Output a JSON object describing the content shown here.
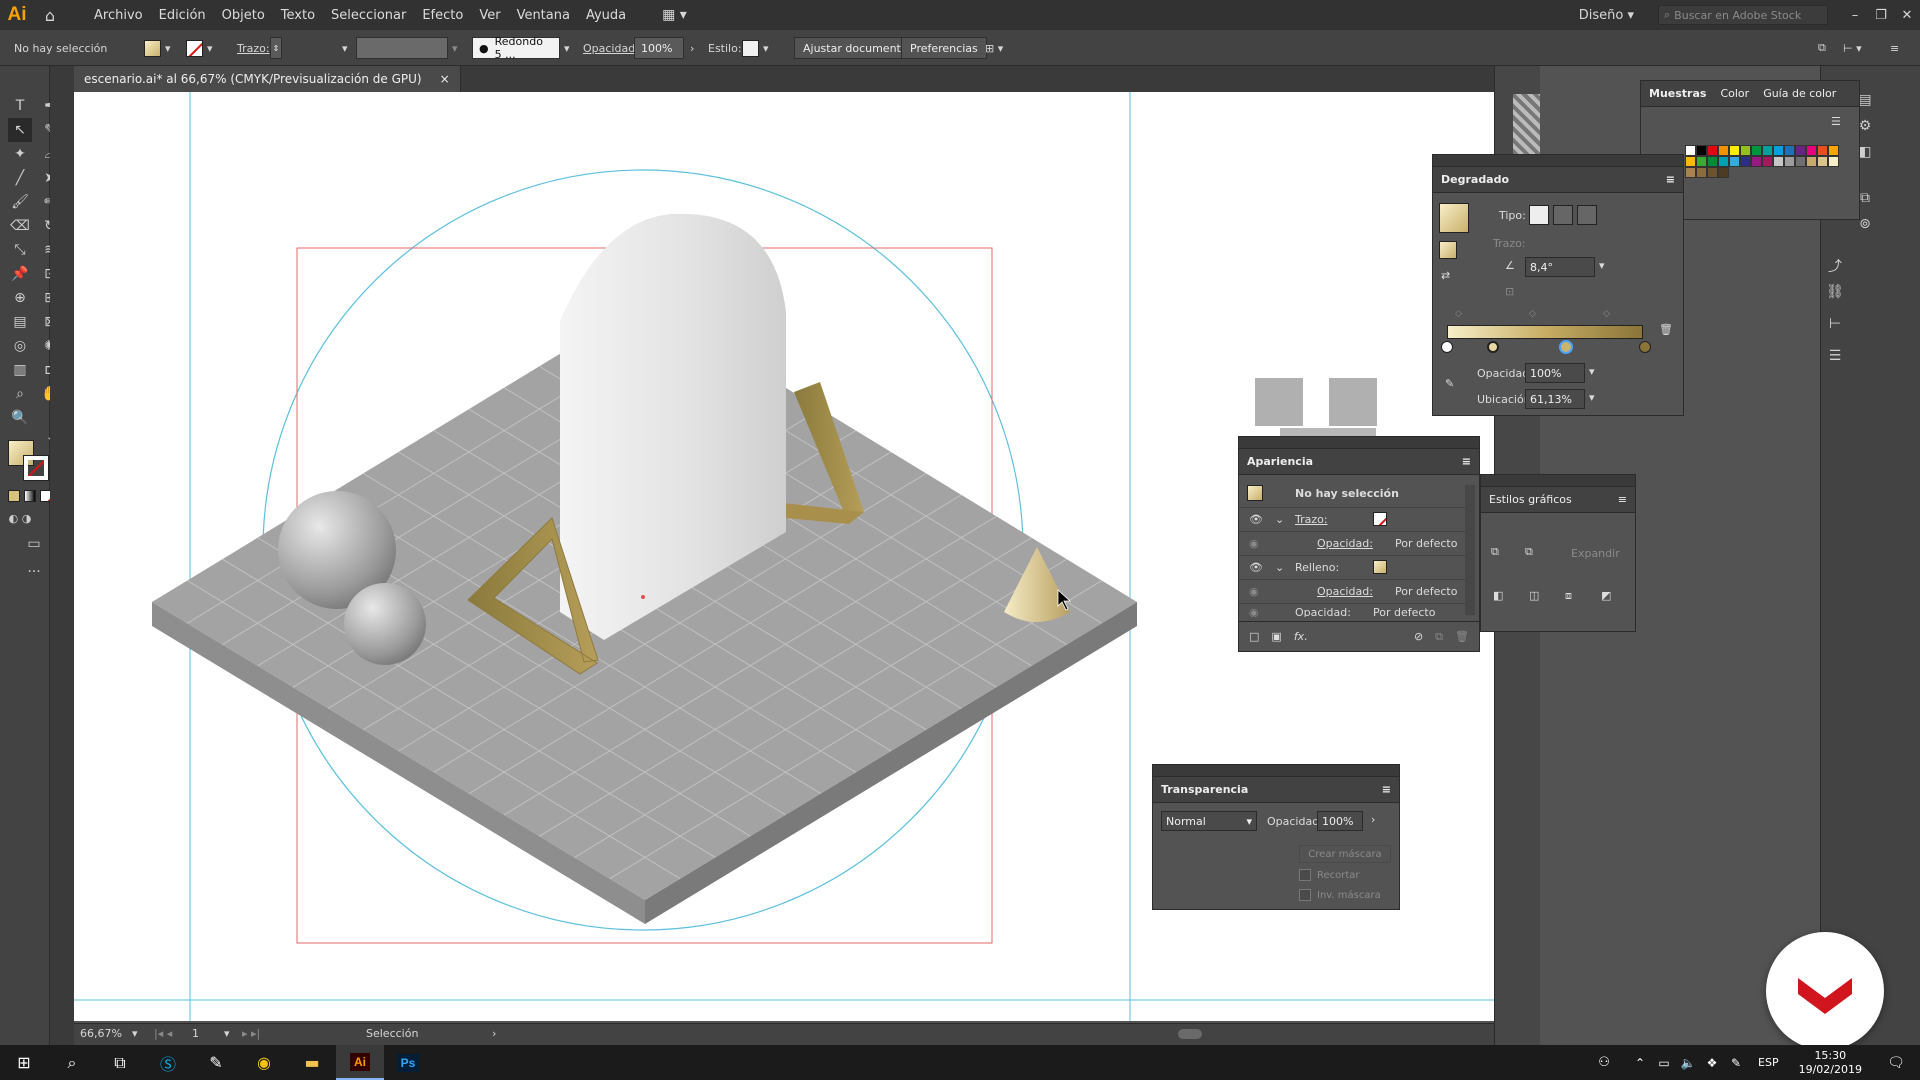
{
  "app": {
    "logo": "Ai",
    "workspace": "Diseño",
    "search_placeholder": "Buscar en Adobe Stock"
  },
  "menu": [
    "Archivo",
    "Edición",
    "Objeto",
    "Texto",
    "Seleccionar",
    "Efecto",
    "Ver",
    "Ventana",
    "Ayuda"
  ],
  "control": {
    "selection_label": "No hay selección",
    "stroke_label": "Trazo:",
    "brush": "Redondo 5 ...",
    "opacity_label": "Opacidad:",
    "opacity_value": "100%",
    "style_label": "Estilo:",
    "fit_doc_button": "Ajustar documento",
    "prefs_button": "Preferencias"
  },
  "document": {
    "tab_title": "escenario.ai* al 66,67% (CMYK/Previsualización de GPU)",
    "close": "×"
  },
  "status": {
    "zoom": "66,67%",
    "page": "1",
    "mode": "Selección"
  },
  "colors": {
    "fill_gold": "#d9c38a",
    "artboard": "#ffffff",
    "ui_bg": "#535353",
    "guide": "#5bc0de",
    "bleed": "#e06060",
    "accent": "#f7a100"
  },
  "samples_panel": {
    "tabs": [
      "Muestras",
      "Color",
      "Guía de color"
    ]
  },
  "gradient_panel": {
    "title": "Degradado",
    "type_label": "Tipo:",
    "stroke_label": "Trazo:",
    "angle": "8,4°",
    "opacity_label": "Opacidad:",
    "opacity_value": "100%",
    "location_label": "Ubicación:",
    "location_value": "61,13%"
  },
  "appearance_panel": {
    "title": "Apariencia",
    "selection": "No hay selección",
    "rows": [
      {
        "label": "Trazo:",
        "kind": "stroke"
      },
      {
        "label": "Opacidad:",
        "value": "Por defecto"
      },
      {
        "label": "Relleno:",
        "kind": "fill"
      },
      {
        "label": "Opacidad:",
        "value": "Por defecto"
      },
      {
        "label": "Opacidad:",
        "value": "Por defecto"
      }
    ],
    "fx": "fx."
  },
  "styles_panel": {
    "title": "Estilos gráficos",
    "expand_button": "Expandir"
  },
  "transparency_panel": {
    "title": "Transparencia",
    "blend_mode": "Normal",
    "opacity_label": "Opacidad:",
    "opacity_value": "100%",
    "mask_button": "Crear máscara",
    "clip_label": "Recortar",
    "invert_label": "Inv. máscara"
  },
  "taskbar": {
    "lang": "ESP",
    "time": "15:30",
    "date": "19/02/2019"
  }
}
